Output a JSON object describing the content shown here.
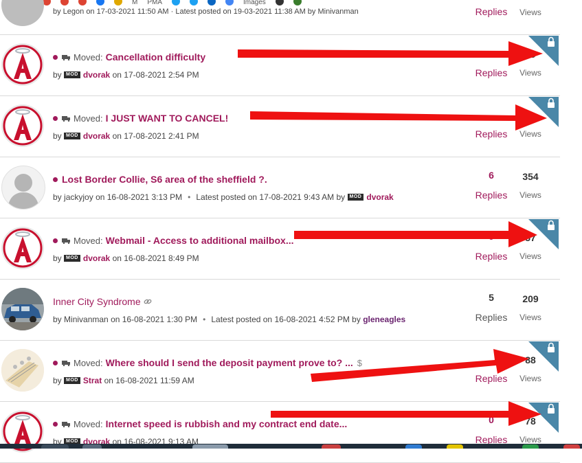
{
  "colors": {
    "accent": "#a01a5b",
    "author_purple": "#6b2570",
    "lock_bg": "#4a87a8",
    "arrow": "#ee1111"
  },
  "top_row": {
    "meta_text": "by Legon on 17-03-2021 11:50 AM · Latest posted on 19-03-2021 11:38 AM by Minivanman",
    "replies_label": "Replies",
    "views_label": "Views"
  },
  "rows": [
    {
      "moved_label": "Moved:",
      "subject": "Cancellation difficulty",
      "by": "by",
      "author": "dvorak",
      "mod_badge": "MOD",
      "date": "on 17-08-2021 2:54 PM",
      "replies_label": "Replies",
      "views": "79",
      "views_label": "Views",
      "locked": true,
      "avatar_icon": "angels-logo-icon"
    },
    {
      "moved_label": "Moved:",
      "subject": "I JUST WANT TO CANCEL!",
      "by": "by",
      "author": "dvorak",
      "mod_badge": "MOD",
      "date": "on 17-08-2021 2:41 PM",
      "replies_label": "Replies",
      "views_label": "Views",
      "locked": true,
      "avatar_icon": "angels-logo-icon"
    },
    {
      "subject": "Lost Border Collie, S6 area of the sheffield ?.",
      "by": "by",
      "author": "jackyjoy",
      "date": "on 16-08-2021 3:13 PM",
      "latest_label": "Latest posted on 17-08-2021 9:43 AM by",
      "latest_author": "dvorak",
      "mod_badge": "MOD",
      "replies": "6",
      "replies_label": "Replies",
      "views": "354",
      "views_label": "Views",
      "avatar_icon": "default-user-silhouette-icon"
    },
    {
      "moved_label": "Moved:",
      "subject": "Webmail - Access to additional mailbox...",
      "by": "by",
      "author": "dvorak",
      "mod_badge": "MOD",
      "date": "on 16-08-2021 8:49 PM",
      "replies": "0",
      "replies_label": "Replies",
      "views": "57",
      "views_label": "Views",
      "locked": true,
      "avatar_icon": "angels-logo-icon"
    },
    {
      "subject": "Inner City Syndrome",
      "by": "by",
      "author": "Minivanman",
      "date": "on 16-08-2021 1:30 PM",
      "latest_label": "Latest posted on 16-08-2021 4:52 PM by",
      "latest_author": "gleneagles",
      "replies": "5",
      "replies_label": "Replies",
      "views": "209",
      "views_label": "Views",
      "avatar_icon": "blue-car-photo-icon"
    },
    {
      "moved_label": "Moved:",
      "subject": "Where should I send the deposit payment prove to? ...",
      "by": "by",
      "author": "Strat",
      "mod_badge": "MOD",
      "date": "on 16-08-2021 11:59 AM",
      "replies_label": "Replies",
      "views": "88",
      "views_label": "Views",
      "locked": true,
      "avatar_icon": "guitar-headstock-photo-icon"
    },
    {
      "moved_label": "Moved:",
      "subject": "Internet speed is rubbish and my contract end date...",
      "by": "by",
      "author": "dvorak",
      "mod_badge": "MOD",
      "date": "on 16-08-2021 9:13 AM",
      "replies": "0",
      "replies_label": "Replies",
      "views": "78",
      "views_label": "Views",
      "locked": true,
      "avatar_icon": "angels-logo-icon"
    }
  ],
  "bookmarks": [
    "Images",
    "M",
    "PMA"
  ]
}
